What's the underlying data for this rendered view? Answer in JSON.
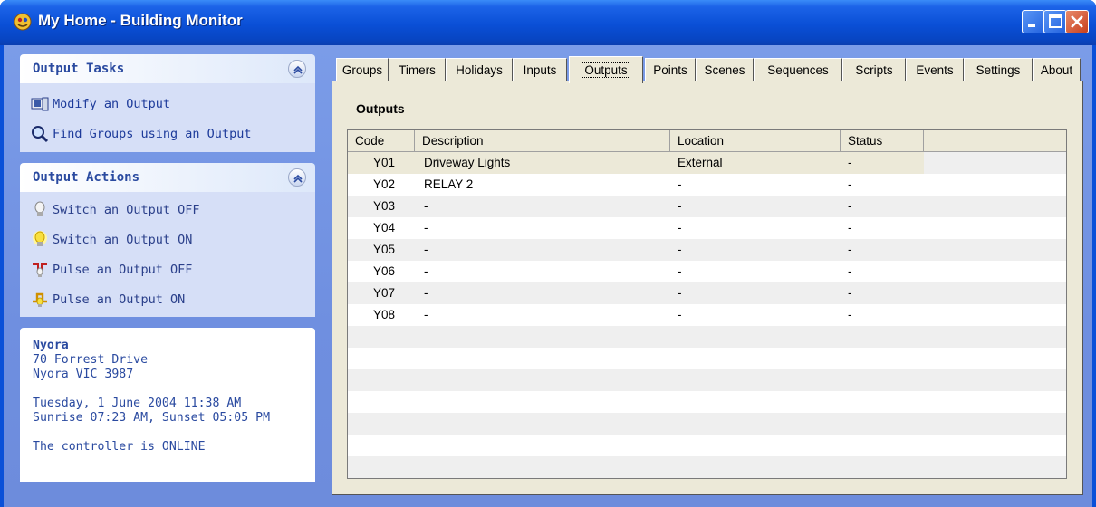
{
  "window": {
    "title": "My Home - Building Monitor"
  },
  "output_tasks": {
    "title": "Output Tasks",
    "items": [
      {
        "label": "Modify an Output",
        "icon": "modify-output-icon"
      },
      {
        "label": "Find Groups using an Output",
        "icon": "magnifier-icon"
      }
    ]
  },
  "output_actions": {
    "title": "Output Actions",
    "items": [
      {
        "label": "Switch an Output OFF",
        "icon": "bulb-off-icon"
      },
      {
        "label": "Switch an Output ON",
        "icon": "bulb-on-icon"
      },
      {
        "label": "Pulse an Output OFF",
        "icon": "pulse-off-icon"
      },
      {
        "label": "Pulse an Output ON",
        "icon": "pulse-on-icon"
      }
    ]
  },
  "info": {
    "name": "Nyora",
    "address1": "70 Forrest Drive",
    "address2": "Nyora VIC 3987",
    "datetime": "Tuesday, 1 June 2004 11:38 AM",
    "sun": "Sunrise 07:23 AM, Sunset 05:05 PM",
    "status": "The controller is ONLINE"
  },
  "tabs": [
    "Groups",
    "Timers",
    "Holidays",
    "Inputs",
    "Outputs",
    "Points",
    "Scenes",
    "Sequences",
    "Scripts",
    "Events",
    "Settings",
    "About"
  ],
  "active_tab": "Outputs",
  "panel": {
    "title": "Outputs"
  },
  "table": {
    "columns": [
      "Code",
      "Description",
      "Location",
      "Status"
    ],
    "rows": [
      [
        "Y01",
        "Driveway Lights",
        "External",
        "-"
      ],
      [
        "Y02",
        "RELAY 2",
        "-",
        "-"
      ],
      [
        "Y03",
        "-",
        "-",
        "-"
      ],
      [
        "Y04",
        "-",
        "-",
        "-"
      ],
      [
        "Y05",
        "-",
        "-",
        "-"
      ],
      [
        "Y06",
        "-",
        "-",
        "-"
      ],
      [
        "Y07",
        "-",
        "-",
        "-"
      ],
      [
        "Y08",
        "-",
        "-",
        "-"
      ]
    ]
  }
}
